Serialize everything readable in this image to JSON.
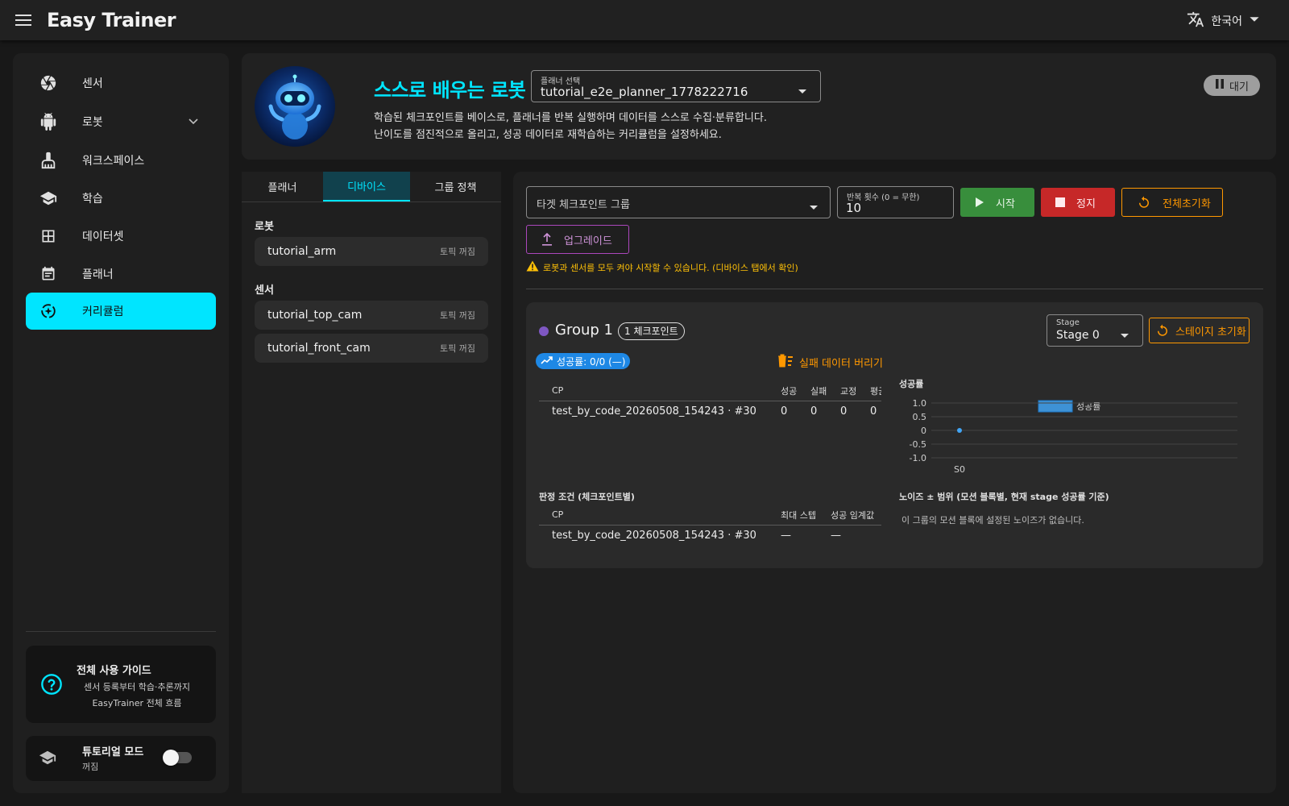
{
  "app": {
    "title": "Easy Trainer",
    "language": "한국어"
  },
  "sidebar": {
    "items": [
      {
        "label": "센서",
        "icon": "camera-aperture-icon"
      },
      {
        "label": "로봇",
        "icon": "robot-icon"
      },
      {
        "label": "워크스페이스",
        "icon": "broom-icon"
      },
      {
        "label": "학습",
        "icon": "graduation-cap-icon"
      },
      {
        "label": "데이터셋",
        "icon": "grid-icon"
      },
      {
        "label": "플래너",
        "icon": "calendar-icon"
      },
      {
        "label": "커리큘럼",
        "icon": "curriculum-icon"
      }
    ],
    "guide": {
      "title": "전체 사용 가이드",
      "desc": "센서 등록부터 학습·추론까지 EasyTrainer 전체 흐름"
    },
    "tutorial": {
      "title": "튜토리얼 모드",
      "status": "꺼짐"
    }
  },
  "header": {
    "title": "스스로 배우는 로봇",
    "planner_caption": "플래너 선택",
    "planner_value": "tutorial_e2e_planner_1778222716",
    "desc_line1": "학습된 체크포인트를 베이스로, 플래너를 반복 실행하며 데이터를 스스로 수집·분류합니다.",
    "desc_line2": "난이도를 점진적으로 올리고, 성공 데이터로 재학습하는 커리큘럼을 설정하세요.",
    "status": "대기"
  },
  "tabs": [
    "플래너",
    "디바이스",
    "그룹 정책"
  ],
  "devices": {
    "robot_title": "로봇",
    "robots": [
      {
        "name": "tutorial_arm",
        "status": "토픽 꺼짐"
      }
    ],
    "sensor_title": "센서",
    "sensors": [
      {
        "name": "tutorial_top_cam",
        "status": "토픽 꺼짐"
      },
      {
        "name": "tutorial_front_cam",
        "status": "토픽 꺼짐"
      }
    ]
  },
  "controls": {
    "target_placeholder": "타겟 체크포인트 그룹",
    "repeat_caption": "반복 횟수 (0 = 무한)",
    "repeat_value": "10",
    "start": "시작",
    "stop": "정지",
    "reset_all": "전체초기화",
    "upgrade": "업그레이드",
    "warning": "로봇과 센서를 모두 켜야 시작할 수 있습니다. (디바이스 탭에서 확인)"
  },
  "group": {
    "name": "Group 1",
    "chip": "1 체크포인트",
    "stage_caption": "Stage",
    "stage_value": "Stage 0",
    "stage_reset": "스테이지 초기화",
    "success_chip": "성공률: 0/0 (—)",
    "discard": "실패 데이터 버리기",
    "cp_headers": [
      "CP",
      "성공",
      "실패",
      "교정",
      "평균"
    ],
    "cp_rows": [
      [
        "test_by_code_20260508_154243 · #30",
        "0",
        "0",
        "0",
        "0"
      ]
    ],
    "judge_title": "판정 조건 (체크포인트별)",
    "judge_headers": [
      "CP",
      "최대 스텝",
      "성공 임계값"
    ],
    "judge_rows": [
      [
        "test_by_code_20260508_154243 · #30",
        "—",
        "—"
      ]
    ],
    "noise_title": "노이즈 ± 범위 (모션 블록별, 현재 stage 성공률 기준)",
    "noise_empty": "이 그룹의 모션 블록에 설정된 노이즈가 없습니다."
  },
  "chart_data": {
    "type": "line",
    "title": "성공률",
    "legend": [
      "성공률"
    ],
    "legend_position": "top-center",
    "categories": [
      "S0"
    ],
    "series": [
      {
        "name": "성공률",
        "values": [
          0
        ]
      }
    ],
    "yticks": [
      "1.0",
      "0.5",
      "0",
      "-0.5",
      "-1.0"
    ],
    "ylim": [
      -1,
      1
    ],
    "grid": true,
    "color": "#42a5f5"
  }
}
